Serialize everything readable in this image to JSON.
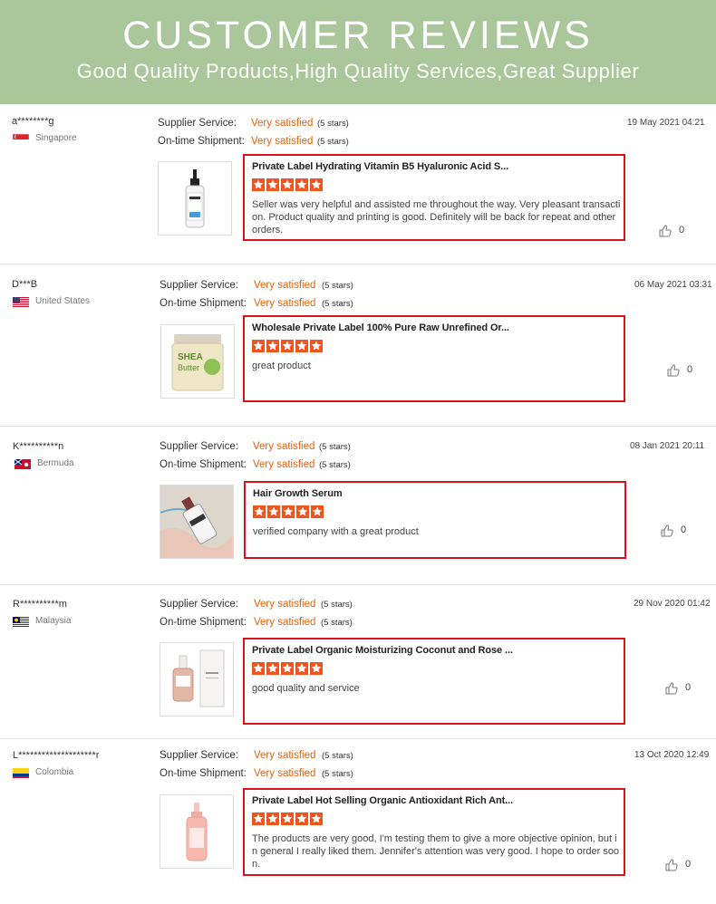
{
  "banner": {
    "title": "CUSTOMER REVIEWS",
    "subtitle": "Good Quality Products,High Quality Services,Great Supplier"
  },
  "colors": {
    "banner_bg": "#a9c79a",
    "accent_orange": "#e8600a",
    "highlight_red": "#d9121b",
    "star_color": "#f2541b"
  },
  "labels": {
    "supplier_service": "Supplier Service:",
    "ontime_shipment": "On-time Shipment:"
  },
  "reviews": [
    {
      "user": "a********g",
      "country": "Singapore",
      "flag": "singapore-flag",
      "supplier_rating": "Very satisfied",
      "supplier_stars": "(5 stars)",
      "shipment_rating": "Very satisfied",
      "shipment_stars": "(5 stars)",
      "date": "19 May 2021 04:21",
      "product_title": "Private Label Hydrating Vitamin B5 Hyaluronic Acid S...",
      "product_image": "serum-bottle-image",
      "rating": 5,
      "comment": "Seller was very helpful and assisted me throughout the way. Very pleasant transaction. Product quality and printing is good. Definitely will be back for repeat and other orders.",
      "likes": "0"
    },
    {
      "user": "D***B",
      "country": "United States",
      "flag": "usa-flag",
      "supplier_rating": "Very satisfied",
      "supplier_stars": "(5 stars)",
      "shipment_rating": "Very satisfied",
      "shipment_stars": "(5 stars)",
      "date": "06 May 2021 03:31",
      "product_title": "Wholesale Private Label 100% Pure Raw Unrefined Or...",
      "product_image": "shea-butter-jar-image",
      "rating": 5,
      "comment": "great product",
      "likes": "0"
    },
    {
      "user": "K**********n",
      "country": "Bermuda",
      "flag": "bermuda-flag",
      "supplier_rating": "Very satisfied",
      "supplier_stars": "(5 stars)",
      "shipment_rating": "Very satisfied",
      "shipment_stars": "(5 stars)",
      "date": "08 Jan 2021 20:11",
      "product_title": "Hair Growth Serum",
      "product_image": "hair-serum-image",
      "rating": 5,
      "comment": "verified company with a great product",
      "likes": "0"
    },
    {
      "user": "R**********m",
      "country": "Malaysia",
      "flag": "malaysia-flag",
      "supplier_rating": "Very satisfied",
      "supplier_stars": "(5 stars)",
      "shipment_rating": "Very satisfied",
      "shipment_stars": "(5 stars)",
      "date": "29 Nov 2020 01:42",
      "product_title": "Private Label Organic Moisturizing Coconut and Rose ...",
      "product_image": "rose-oil-bottle-image",
      "rating": 5,
      "comment": "good quality and service",
      "likes": "0"
    },
    {
      "user": "L********************r",
      "country": "Colombia",
      "flag": "colombia-flag",
      "supplier_rating": "Very satisfied",
      "supplier_stars": "(5 stars)",
      "shipment_rating": "Very satisfied",
      "shipment_stars": "(5 stars)",
      "date": "13 Oct 2020 12:49",
      "product_title": "Private Label Hot Selling Organic Antioxidant Rich Ant...",
      "product_image": "pink-serum-image",
      "rating": 5,
      "comment": "The products are very good, I'm testing them to give a more objective opinion, but in general I really liked them. Jennifer's attention was very good. I hope to order soon.",
      "likes": "0"
    }
  ]
}
